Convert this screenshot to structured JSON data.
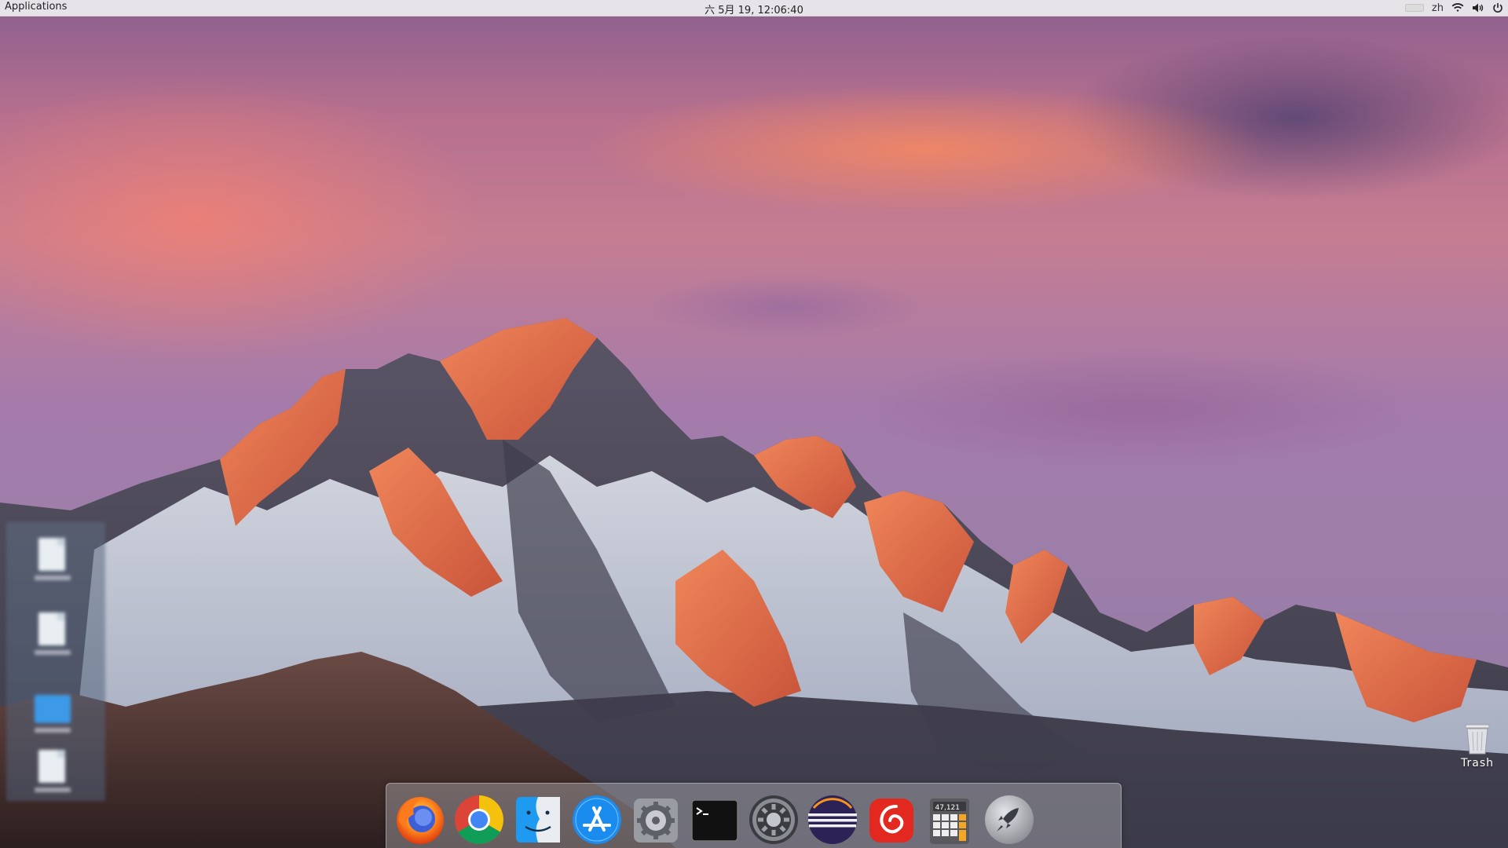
{
  "topbar": {
    "apps_label": "Applications",
    "clock": "六 5月 19, 12:06:40",
    "lang": "zh",
    "tray_icons": [
      "keyboard-layout-icon",
      "wifi-icon",
      "volume-icon",
      "power-icon"
    ]
  },
  "desktop": {
    "icons": [
      {
        "name": "desktop-file-1",
        "kind": "file"
      },
      {
        "name": "desktop-file-2",
        "kind": "file"
      },
      {
        "name": "desktop-folder",
        "kind": "folder"
      },
      {
        "name": "desktop-file-3",
        "kind": "file"
      }
    ],
    "trash_label": "Trash"
  },
  "dock": {
    "items": [
      {
        "name": "firefox",
        "icon": "firefox-icon"
      },
      {
        "name": "chrome",
        "icon": "chrome-icon"
      },
      {
        "name": "finder",
        "icon": "finder-icon"
      },
      {
        "name": "app-store",
        "icon": "app-store-icon"
      },
      {
        "name": "settings",
        "icon": "settings-gear-icon"
      },
      {
        "name": "terminal",
        "icon": "terminal-icon"
      },
      {
        "name": "system-preferences",
        "icon": "system-preferences-icon"
      },
      {
        "name": "eclipse",
        "icon": "eclipse-icon"
      },
      {
        "name": "netease-music",
        "icon": "netease-music-icon"
      },
      {
        "name": "calculator",
        "icon": "calculator-icon",
        "display": "47,121"
      },
      {
        "name": "launchpad",
        "icon": "launchpad-rocket-icon"
      }
    ]
  },
  "colors": {
    "dock_bg": "#d2d2d7",
    "topbar_bg": "#eeeef0",
    "finder_blue": "#1e9bf0",
    "appstore_blue": "#1a8cf0",
    "netease_red": "#e3281f",
    "eclipse_navy": "#2c2255"
  }
}
